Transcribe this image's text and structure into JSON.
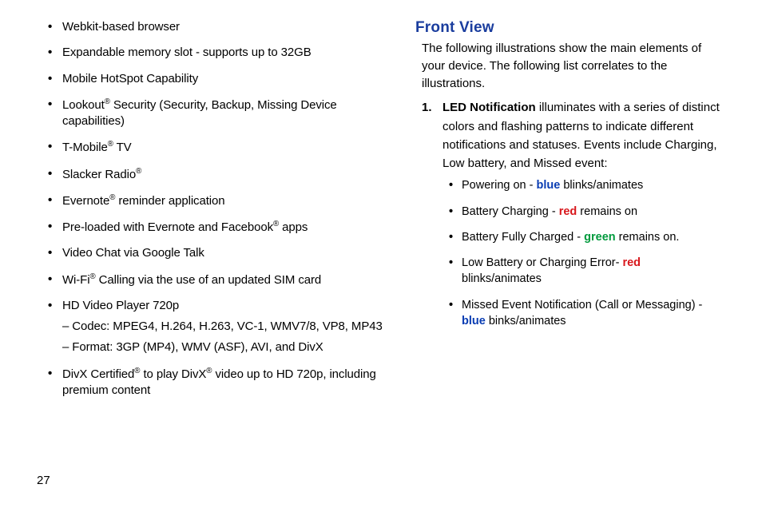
{
  "left": {
    "b1": "Webkit-based browser",
    "b2": "Expandable memory slot - supports up to 32GB",
    "b3": "Mobile HotSpot Capability",
    "b4a": "Lookout",
    "b4b": " Security (Security, Backup, Missing Device capabilities)",
    "b5a": "T-Mobile",
    "b5b": " TV",
    "b6a": "Slacker Radio",
    "b7a": "Evernote",
    "b7b": "  reminder application",
    "b8a": "Pre-loaded with Evernote and Facebook",
    "b8b": " apps",
    "b9": "Video Chat via Google Talk",
    "b10a": "Wi-Fi",
    "b10b": " Calling via the use of an updated SIM card",
    "b11": "HD Video Player 720p",
    "b11s1": "– Codec: MPEG4, H.264, H.263, VC-1, WMV7/8, VP8, MP43",
    "b11s2": "– Format: 3GP (MP4), WMV (ASF), AVI, and DivX",
    "b12a": "DivX Certified",
    "b12b": " to play DivX",
    "b12c": "  video up to HD 720p, including premium content"
  },
  "right": {
    "heading": "Front View",
    "intro": "The following illustrations show the main elements of your device. The following list correlates to the illustrations.",
    "num1": "1.",
    "led_label": "LED Notification",
    "led_rest": " illuminates with a series of distinct colors and flashing patterns to indicate different notifications and statuses. Events include Charging, Low battery, and Missed event:",
    "s1a": "Powering on - ",
    "s1c": " blinks/animates",
    "s2a": "Battery Charging - ",
    "s2c": " remains on",
    "s3a": "Battery Fully Charged - ",
    "s3c": " remains on.",
    "s4a": "Low Battery or Charging Error- ",
    "s4c": " blinks/animates",
    "s5a": "Missed Event Notification (Call or Messaging) - ",
    "s5c": " binks/animates",
    "blue": "blue",
    "red": "red",
    "green": "green"
  },
  "reg": "®",
  "page": "27"
}
